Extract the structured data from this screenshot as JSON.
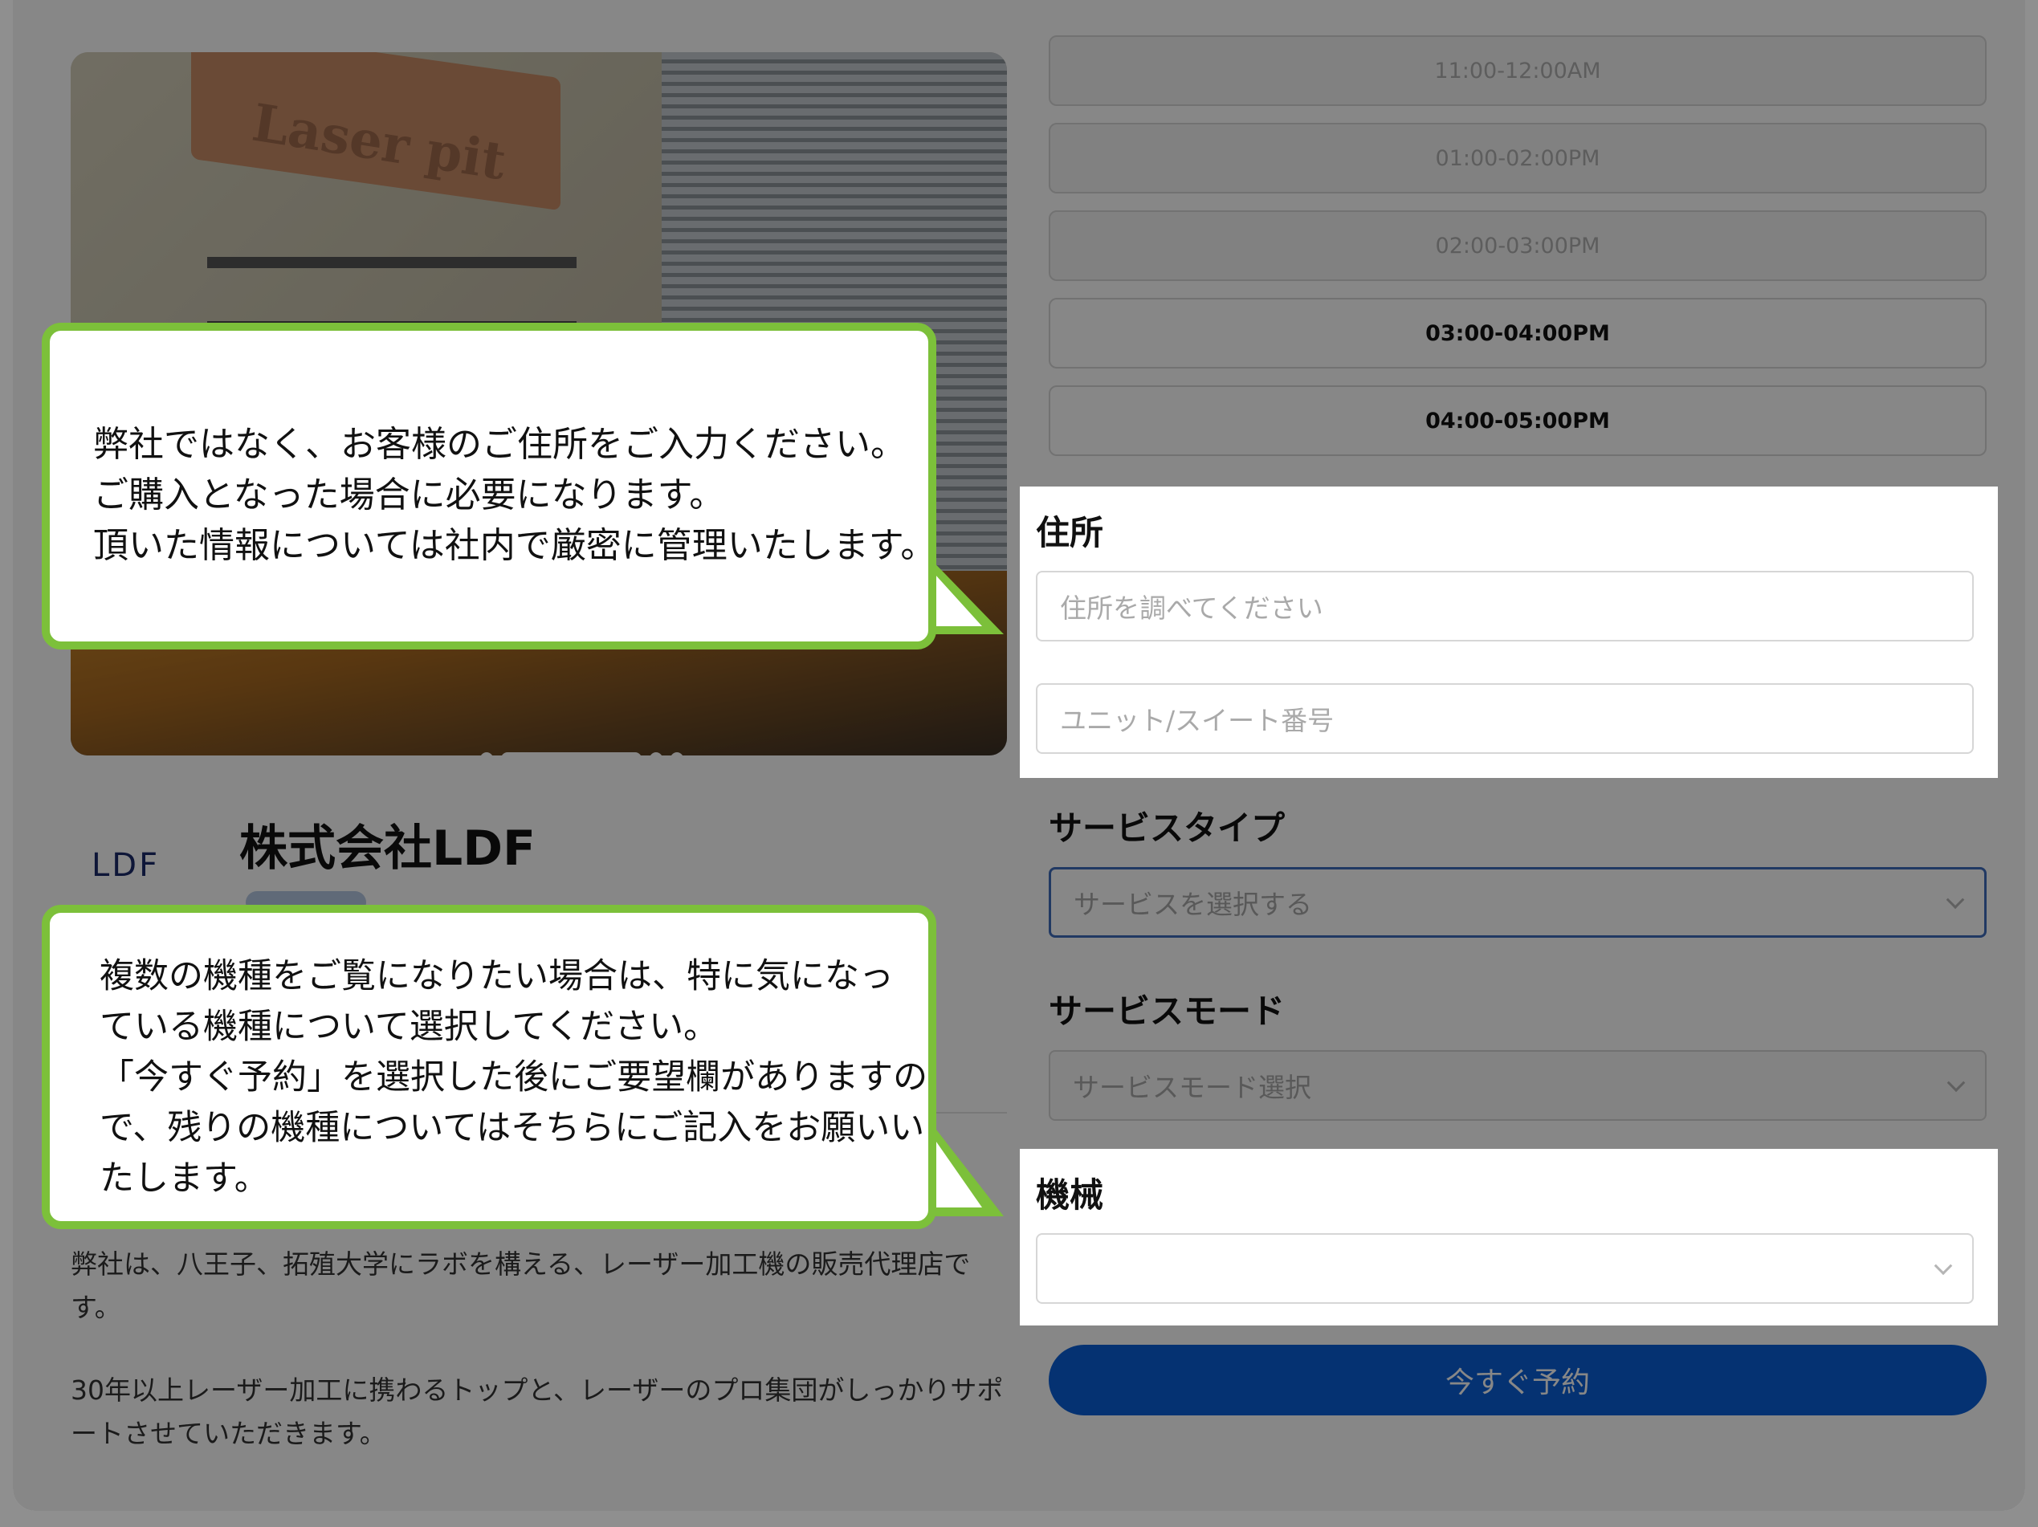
{
  "time_slots": [
    {
      "label": "11:00-12:00AM",
      "available": false
    },
    {
      "label": "01:00-02:00PM",
      "available": false
    },
    {
      "label": "02:00-03:00PM",
      "available": false
    },
    {
      "label": "03:00-04:00PM",
      "available": true
    },
    {
      "label": "04:00-05:00PM",
      "available": true
    }
  ],
  "address": {
    "label": "住所",
    "search_placeholder": "住所を調べてください",
    "unit_placeholder": "ユニット/スイート番号"
  },
  "service_type": {
    "label": "サービスタイプ",
    "placeholder": "サービスを選択する"
  },
  "service_mode": {
    "label": "サービスモード",
    "placeholder": "サービスモード選択"
  },
  "machine": {
    "label": "機械",
    "value": ""
  },
  "reserve_button": "今すぐ予約",
  "hero": {
    "sign_text": "Laser pit",
    "carousel_count": 4,
    "carousel_active": 1
  },
  "company": {
    "logo_text": "LDF",
    "name": "株式会社LDF",
    "description_1": "弊社は、八王子、拓殖大学にラボを構える、レーザー加工機の販売代理店です。",
    "description_2": "30年以上レーザー加工に携わるトップと、レーザーのプロ集団がしっかりサポートさせていただきます。"
  },
  "callouts": {
    "address_note": [
      "弊社ではなく、お客様のご住所をご入力ください。",
      "ご購入となった場合に必要になります。",
      "頂いた情報については社内で厳密に管理いたします。"
    ],
    "machine_note": [
      "複数の機種をご覧になりたい場合は、特に気になっ",
      "ている機種について選択してください。",
      "「今すぐ予約」を選択した後にご要望欄がありますの",
      "で、残りの機種についてはそちらにご記入をお願いい",
      "たします。"
    ]
  },
  "colors": {
    "callout_border": "#7cc03a",
    "primary_button": "#0a5fd8",
    "focus_border": "#3f6dbb"
  }
}
